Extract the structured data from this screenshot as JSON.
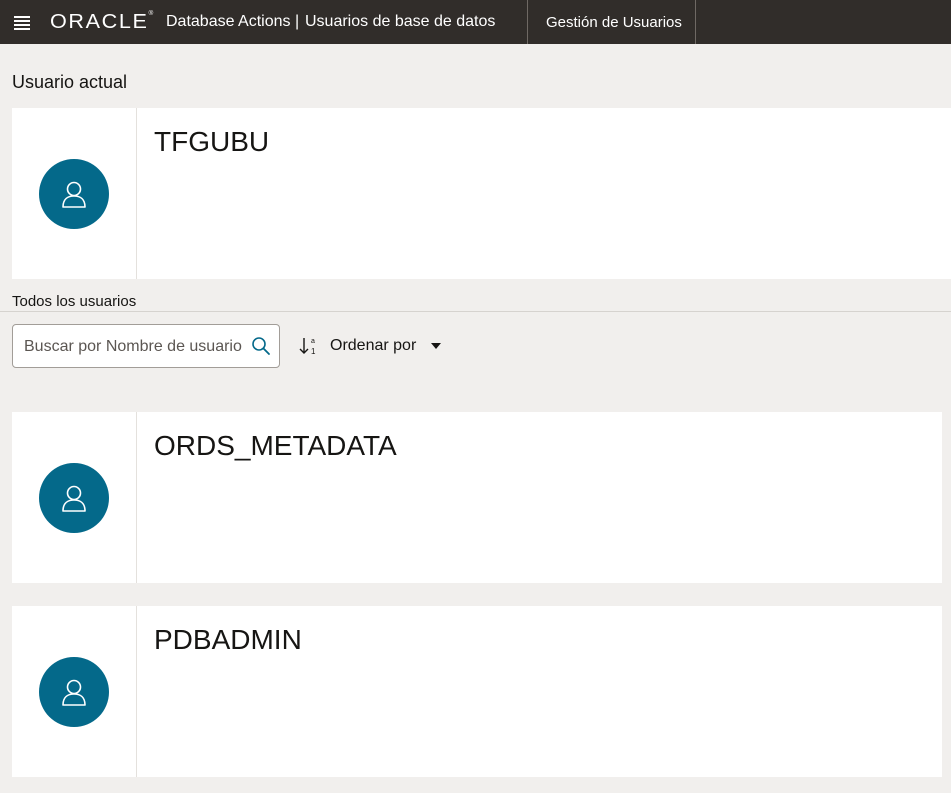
{
  "header": {
    "logo_text": "ORACLE",
    "app_title": "Database Actions |",
    "page_title": "Usuarios de base de datos",
    "nav_tab": "Gestión de Usuarios"
  },
  "current_user": {
    "heading": "Usuario actual",
    "name": "TFGUBU",
    "avatar_icon": "user-icon"
  },
  "all_users": {
    "heading": "Todos los usuarios",
    "search_placeholder": "Buscar por Nombre de usuario",
    "sort_label": "Ordenar por",
    "users": [
      {
        "name": "ORDS_METADATA",
        "avatar_icon": "user-icon"
      },
      {
        "name": "PDBADMIN",
        "avatar_icon": "user-icon"
      }
    ]
  },
  "colors": {
    "topbar": "#312d2a",
    "avatar": "#04698a",
    "background": "#f1efed"
  }
}
